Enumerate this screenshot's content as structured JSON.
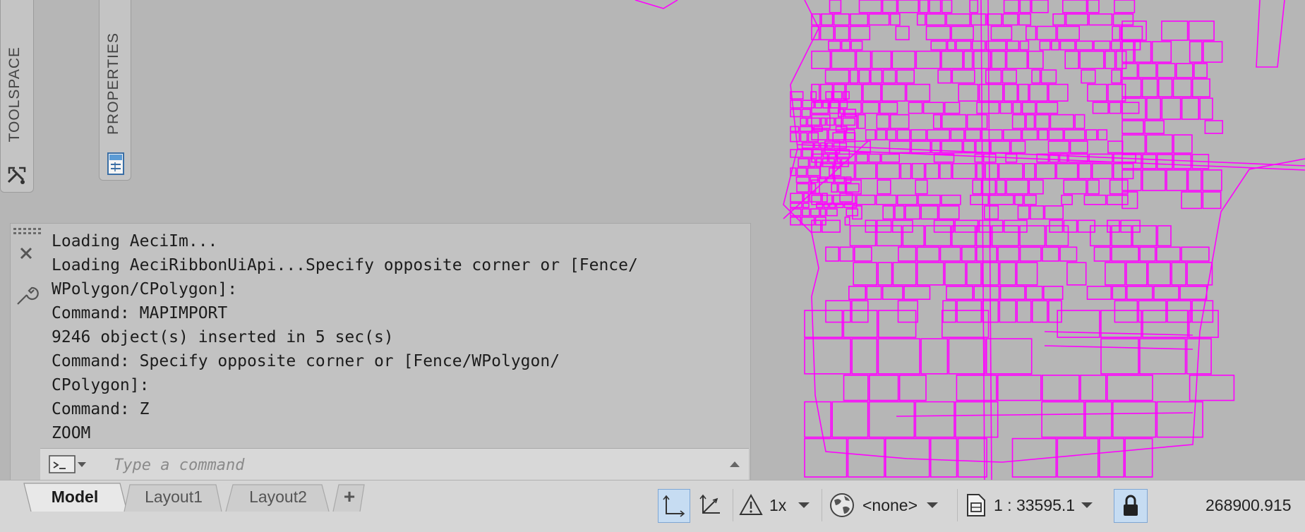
{
  "palettes": {
    "toolspace_label": "TOOLSPACE",
    "properties_label": "PROPERTIES"
  },
  "command_window": {
    "history": [
      "Loading AeciIm...",
      "Loading AeciRibbonUiApi...Specify opposite corner or [Fence/",
      "WPolygon/CPolygon]:",
      "Command: MAPIMPORT",
      "9246 object(s) inserted in 5 sec(s)",
      "Command: Specify opposite corner or [Fence/WPolygon/",
      "CPolygon]:",
      "Command: Z",
      "ZOOM"
    ],
    "input_placeholder": "Type a command"
  },
  "layout_tabs": [
    "Model",
    "Layout1",
    "Layout2"
  ],
  "add_tab_symbol": "+",
  "status": {
    "annotation_scale": "1x",
    "coordinate_system": "<none>",
    "viewport_scale": "1 : 33595.1",
    "coordinates": "268900.915"
  },
  "colors": {
    "linework": "#ff00ff",
    "canvas": "#b6b6b6"
  }
}
